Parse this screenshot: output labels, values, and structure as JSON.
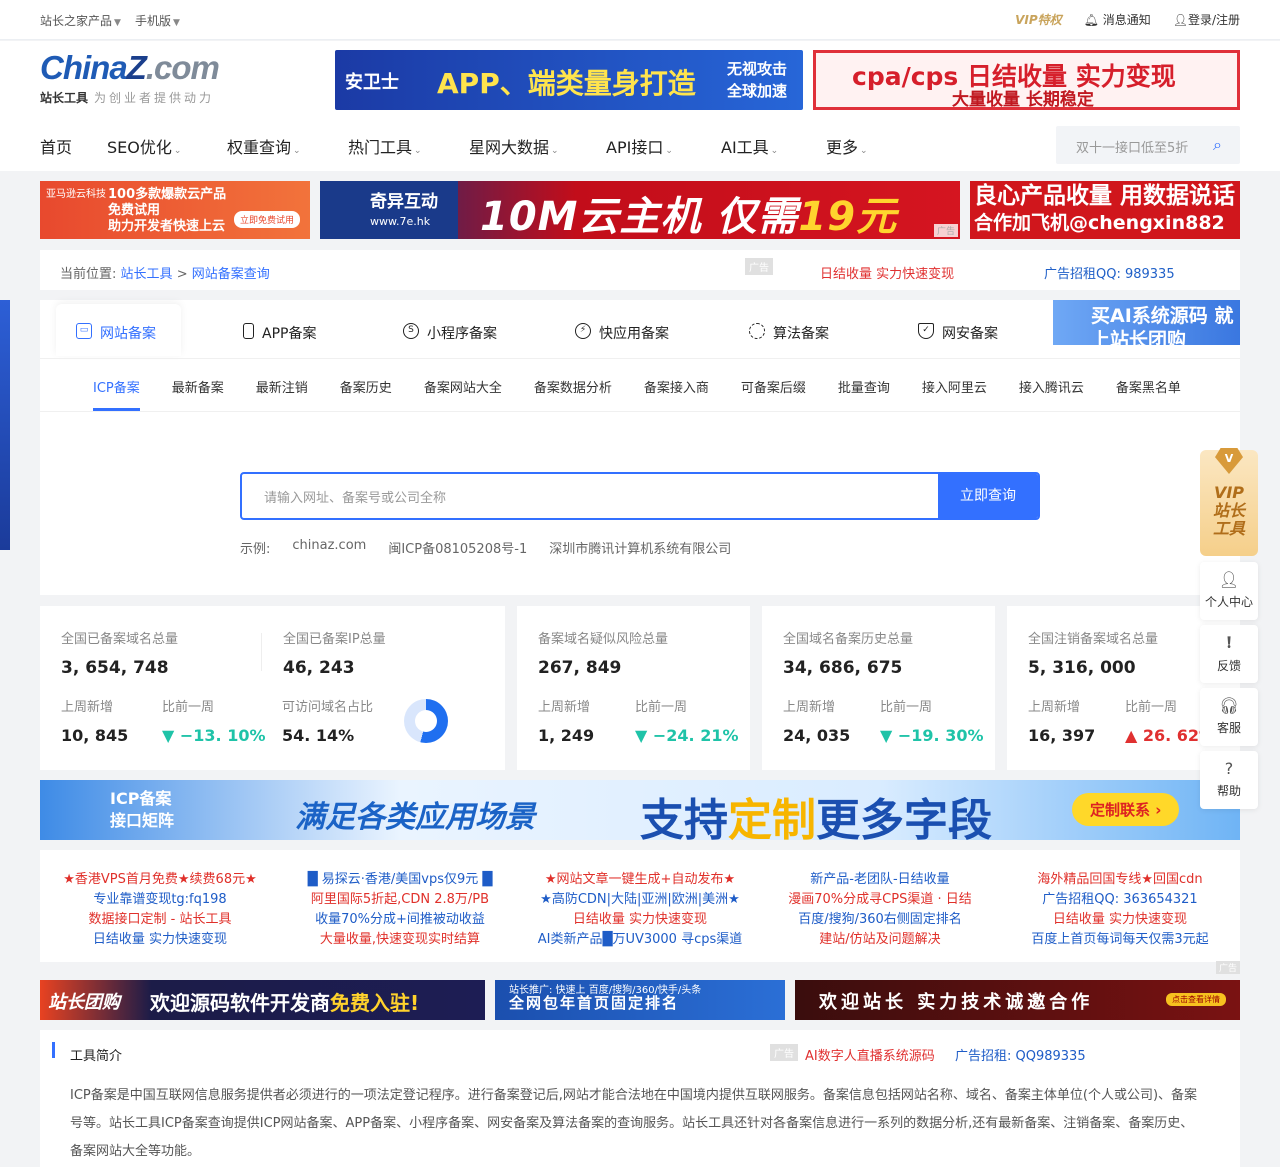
{
  "topbar": {
    "products": "站长之家产品",
    "mobile": "手机版",
    "vip": "VIP特权",
    "notify": "消息通知",
    "login": "登录/注册"
  },
  "logo": {
    "china": "China",
    "z": "Z",
    "com": ".com",
    "sub": "站长工具",
    "slogan": "为创业者提供动力"
  },
  "header_ads": {
    "ad1_brand": "安卫士",
    "ad1_text": "APP、端类量身打造",
    "ad1_side": "无视攻击 全球加速",
    "ad2_top": "cpa/cps 日结收量 实力变现",
    "ad2_bottom": "大量收量 长期稳定"
  },
  "nav": [
    "首页",
    "SEO优化",
    "权重查询",
    "热门工具",
    "星网大数据",
    "API接口",
    "AI工具",
    "更多"
  ],
  "search": {
    "placeholder": "双十一接口低至5折"
  },
  "banners": {
    "b1_brand": "亚马逊云科技",
    "b1_l1": "100多款爆款云产品",
    "b1_l2": "免费试用",
    "b1_l3": "助力开发者快速上云",
    "b1_btn": "立即免费试用",
    "b2_brand": "奇异互动",
    "b2_url": "www.7e.hk",
    "b2_big": "10M云主机 仅需",
    "b2_price": "19元",
    "b3_l1": "良心产品收量 用数据说话",
    "b3_l2": "合作加飞机@chengxin882",
    "ad": "广告"
  },
  "crumb": {
    "label": "当前位置:",
    "home": "站长工具",
    "sep": ">",
    "current": "网站备案查询",
    "ad_text": "日结收量 实力快速变现",
    "ad_qq": "广告招租QQ: 989335"
  },
  "tabs_primary": [
    "网站备案",
    "APP备案",
    "小程序备案",
    "快应用备案",
    "算法备案",
    "网安备案"
  ],
  "ai_box": "买AI系统源码 就上站长团购",
  "tabs_secondary": [
    "ICP备案",
    "最新备案",
    "最新注销",
    "备案历史",
    "备案网站大全",
    "备案数据分析",
    "备案接入商",
    "可备案后缀",
    "批量查询",
    "接入阿里云",
    "接入腾讯云",
    "备案黑名单"
  ],
  "query": {
    "placeholder": "请输入网址、备案号或公司全称",
    "button": "立即查询",
    "example_label": "示例:",
    "ex1": "chinaz.com",
    "ex2": "闽ICP备08105208号-1",
    "ex3": "深圳市腾讯计算机系统有限公司"
  },
  "stats": {
    "c1": {
      "l1": "全国已备案域名总量",
      "v1": "3, 654, 748",
      "l2": "全国已备案IP总量",
      "v2": "46, 243",
      "l3": "上周新增",
      "v3": "10, 845",
      "l4": "比前一周",
      "v4": "−13. 10%",
      "l5": "可访问域名占比",
      "v5": "54. 14%"
    },
    "c2": {
      "l1": "备案域名疑似风险总量",
      "v1": "267, 849",
      "l3": "上周新增",
      "v3": "1, 249",
      "l4": "比前一周",
      "v4": "−24. 21%"
    },
    "c3": {
      "l1": "全国域名备案历史总量",
      "v1": "34, 686, 675",
      "l3": "上周新增",
      "v3": "24, 035",
      "l4": "比前一周",
      "v4": "−19. 30%"
    },
    "c4": {
      "l1": "全国注销备案域名总量",
      "v1": "5, 316, 000",
      "l3": "上周新增",
      "v3": "16, 397",
      "l4": "比前一周",
      "v4": "26. 62%"
    }
  },
  "accessible_ratio": 0.5414,
  "icp_banner": {
    "a1": "ICP备案",
    "a2": "接口矩阵",
    "b": "满足各类应用场景",
    "c1": "支持",
    "c2": "定制",
    "c3": "更多字段",
    "d": "定制联系 ›"
  },
  "text_ads": [
    [
      "★香港VPS首月免费★续费68元★",
      "专业靠谱变现tg:fq198",
      "数据接口定制 - 站长工具",
      "日结收量 实力快速变现"
    ],
    [
      "█ 易探云·香港/美国vps仅9元 █",
      "阿里国际5折起,CDN 2.8万/PB",
      "收量70%分成+间推被动收益",
      "大量收量,快速变现实时结算"
    ],
    [
      "★网站文章一键生成+自动发布★",
      "★高防CDN|大陆|亚洲|欧洲|美洲★",
      "日结收量 实力快速变现",
      "AI类新产品█万UV3000 寻cps渠道"
    ],
    [
      "新产品-老团队-日结收量",
      "漫画70%分成寻CPS渠道 · 日结",
      "百度/搜狗/360右侧固定排名",
      "建站/仿站及问题解决"
    ],
    [
      "海外精品回国专线★回国cdn",
      "广告招租QQ: 363654321",
      "日结收量 实力快速变现",
      "百度上首页每词每天仅需3元起"
    ]
  ],
  "bottom_banners": {
    "b1_tag": "站长团购",
    "b1_text": "欢迎源码软件开发商",
    "b1_free": "免费入驻!",
    "b2_top": "站长推广: 快速上 百度/搜狗/360/快手/头条",
    "b2_main": "全网包年首页固定排名",
    "b3_text": "欢迎站长 实力技术诚邀合作",
    "b3_btn": "点击查看详情"
  },
  "intro": {
    "title": "工具简介",
    "ad_text": "AI数字人直播系统源码",
    "ad_qq": "广告招租: QQ989335",
    "body": "ICP备案是中国互联网信息服务提供者必须进行的一项法定登记程序。进行备案登记后,网站才能合法地在中国境内提供互联网服务。备案信息包括网站名称、域名、备案主体单位(个人或公司)、备案号等。站长工具ICP备案查询提供ICP网站备案、APP备案、小程序备案、网安备案及算法备案的查询服务。站长工具还针对各备案信息进行一系列的数据分析,还有最新备案、注销备案、备案历史、备案网站大全等功能。"
  },
  "float": {
    "vip": "VIP 站长 工具",
    "vip_badge": "V",
    "personal": "个人中心",
    "feedback": "反馈",
    "service": "客服",
    "help": "帮助"
  },
  "colors": {
    "primary": "#3370ff",
    "red": "#e03030",
    "green": "#1fc3a8"
  }
}
